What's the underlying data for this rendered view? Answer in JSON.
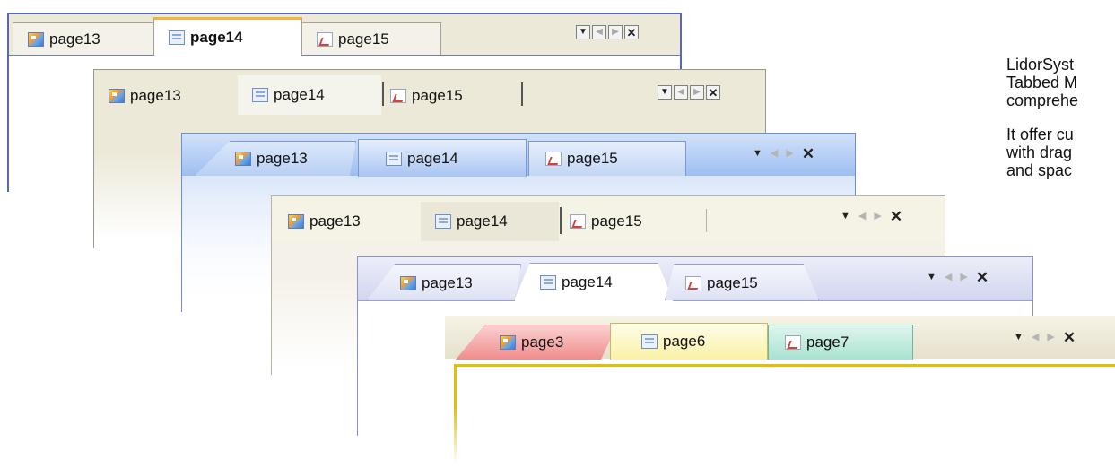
{
  "panels": [
    {
      "tabs": [
        {
          "label": "page13",
          "icon": "image-icon"
        },
        {
          "label": "page14",
          "icon": "document-icon"
        },
        {
          "label": "page15",
          "icon": "pdf-icon"
        }
      ],
      "controls": [
        "dropdown",
        "scroll-left",
        "scroll-right",
        "close"
      ]
    },
    {
      "tabs": [
        {
          "label": "page13",
          "icon": "image-icon"
        },
        {
          "label": "page14",
          "icon": "document-icon"
        },
        {
          "label": "page15",
          "icon": "pdf-icon"
        }
      ],
      "controls": [
        "dropdown",
        "scroll-left",
        "scroll-right",
        "close"
      ]
    },
    {
      "tabs": [
        {
          "label": "page13",
          "icon": "image-icon"
        },
        {
          "label": "page14",
          "icon": "document-icon"
        },
        {
          "label": "page15",
          "icon": "pdf-icon"
        }
      ],
      "controls": [
        "dropdown",
        "scroll-left",
        "scroll-right",
        "close"
      ]
    },
    {
      "tabs": [
        {
          "label": "page13",
          "icon": "image-icon"
        },
        {
          "label": "page14",
          "icon": "document-icon"
        },
        {
          "label": "page15",
          "icon": "pdf-icon"
        }
      ],
      "controls": [
        "dropdown",
        "scroll-left",
        "scroll-right",
        "close"
      ]
    },
    {
      "tabs": [
        {
          "label": "page13",
          "icon": "image-icon"
        },
        {
          "label": "page14",
          "icon": "document-icon"
        },
        {
          "label": "page15",
          "icon": "pdf-icon"
        }
      ],
      "controls": [
        "dropdown",
        "scroll-left",
        "scroll-right",
        "close"
      ]
    },
    {
      "tabs": [
        {
          "label": "page3",
          "icon": "image-icon"
        },
        {
          "label": "page6",
          "icon": "document-icon"
        },
        {
          "label": "page7",
          "icon": "pdf-icon"
        }
      ],
      "controls": [
        "dropdown",
        "scroll-left",
        "scroll-right",
        "close"
      ]
    }
  ],
  "description": {
    "lines1": [
      "LidorSyst",
      "Tabbed M",
      "comprehe"
    ],
    "lines2": [
      "It offer cu",
      "with drag",
      "and spac"
    ]
  },
  "colors": {
    "vs2005_border": "#5a6aa8",
    "vs2005_active_accent": "#f3b33d",
    "classic_strip": "#ece9d8",
    "blue_strip": "#9ebef0",
    "lavender_strip": "#d6d9f0",
    "tab_page3": "#f7a0a0",
    "tab_page6": "#faf6c0",
    "tab_page7": "#bfe9dc",
    "last_border": "#e0c200"
  }
}
